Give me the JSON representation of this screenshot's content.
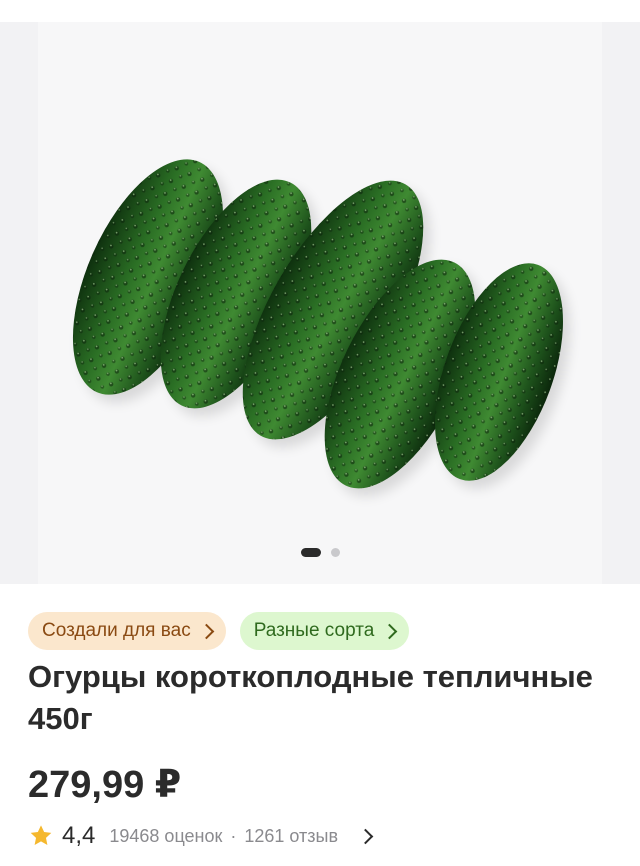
{
  "product": {
    "image_icon": "cucumbers-photo",
    "gallery": {
      "total_slides": 2,
      "active_slide": 1
    },
    "badges": [
      {
        "label": "Создали для вас",
        "color": "#fbe7cd"
      },
      {
        "label": "Разные сорта",
        "color": "#ddf7cf"
      }
    ],
    "title": "Огурцы короткоплодные тепличные 450г",
    "price": "279,99 ₽",
    "rating": {
      "value": "4,4",
      "count_text": "19468 оценок",
      "separator": "·",
      "reviews_text": "1261 отзыв"
    }
  },
  "colors": {
    "star": "#f5b82e",
    "cucumber_dark": "#123a12",
    "cucumber_mid": "#1f5e1f",
    "text_primary": "#2b2b2b",
    "text_secondary": "#8a8a8e"
  }
}
